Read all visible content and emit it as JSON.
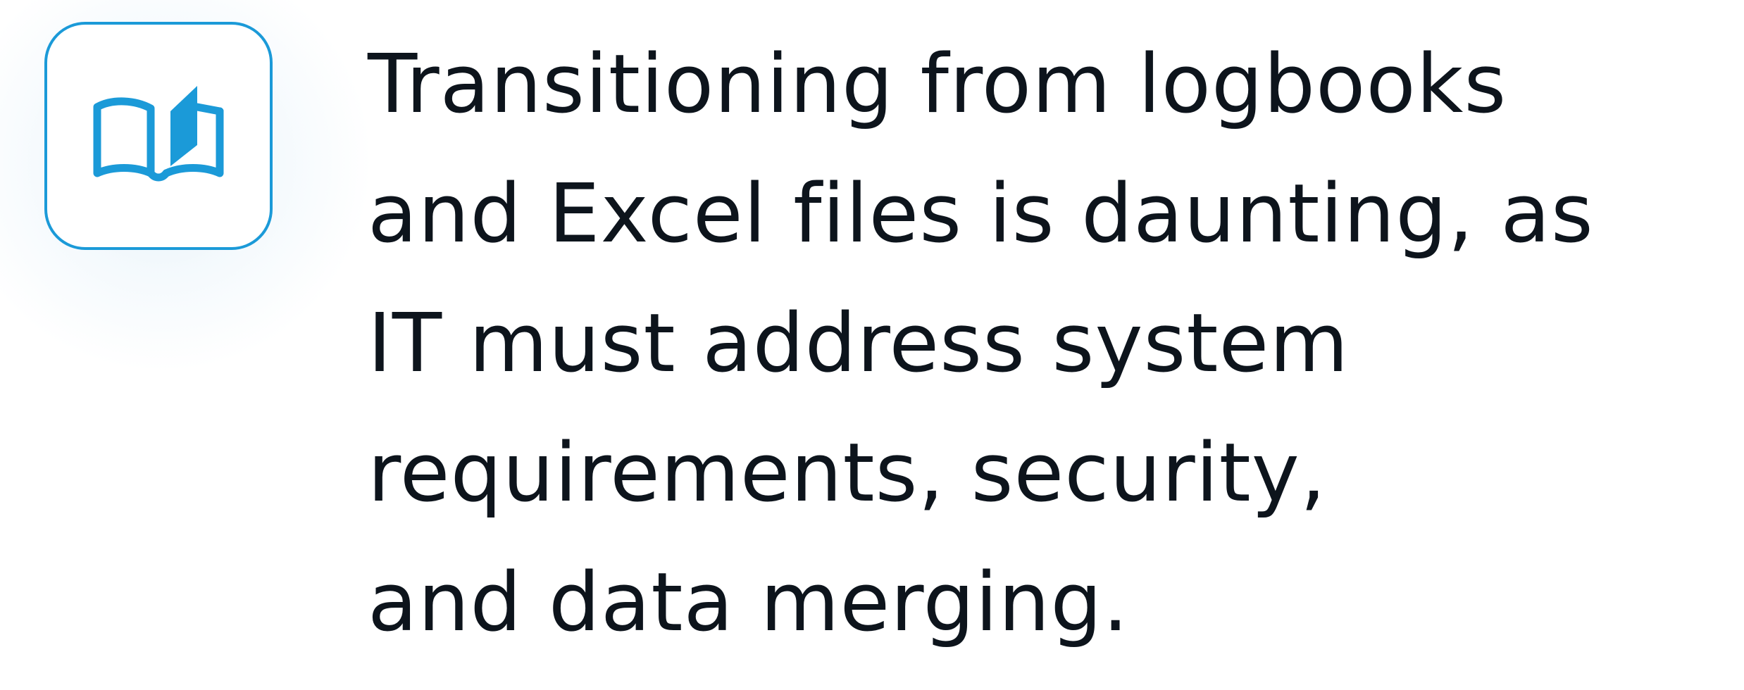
{
  "icon": {
    "name": "open-book-icon",
    "accent_color": "#1b9ad8"
  },
  "headline": {
    "lines": [
      "Transitioning from logbooks",
      "and Excel files is daunting, as",
      "IT must address system",
      "requirements, security,",
      "and data merging."
    ]
  },
  "colors": {
    "text": "#0d141c",
    "background": "#ffffff"
  }
}
